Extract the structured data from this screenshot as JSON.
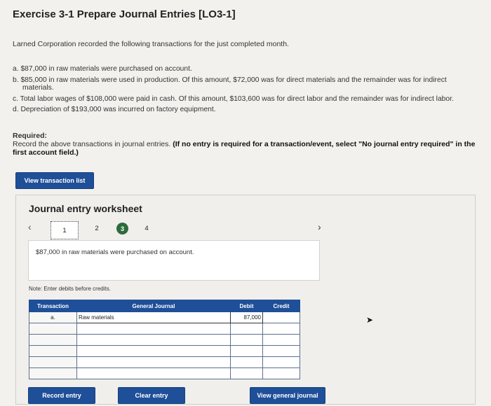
{
  "exercise": {
    "title": "Exercise 3-1 Prepare Journal Entries [LO3-1]",
    "intro": "Larned Corporation recorded the following transactions for the just completed month.",
    "transactions": [
      "a. $87,000 in raw materials were purchased on account.",
      "b. $85,000 in raw materials were used in production. Of this amount, $72,000 was for direct materials and the remainder was for indirect materials.",
      "c. Total labor wages of $108,000 were paid in cash. Of this amount, $103,600 was for direct labor and the remainder was for indirect labor.",
      "d. Depreciation of $193,000 was incurred on factory equipment."
    ],
    "required_heading": "Required:",
    "required_text": "Record the above transactions in journal entries.",
    "required_note": "(If no entry is required for a transaction/event, select \"No journal entry required\" in the first account field.)"
  },
  "buttons": {
    "view_transaction_list": "View transaction list",
    "record_entry": "Record entry",
    "clear_entry": "Clear entry",
    "view_general_journal": "View general journal"
  },
  "worksheet": {
    "title": "Journal entry worksheet",
    "prev_icon": "chevron-left-icon",
    "next_icon": "chevron-right-icon",
    "steps": [
      "1",
      "2",
      "3",
      "4"
    ],
    "current_step": "1",
    "completed_step": "3",
    "description": "$87,000 in raw materials were purchased on account.",
    "note": "Note: Enter debits before credits."
  },
  "journal_table": {
    "headers": {
      "transaction": "Transaction",
      "general_journal": "General Journal",
      "debit": "Debit",
      "credit": "Credit"
    },
    "rows": [
      {
        "transaction": "a.",
        "account": "Raw materials",
        "debit": "87,000",
        "credit": ""
      },
      {
        "transaction": "",
        "account": "",
        "debit": "",
        "credit": ""
      },
      {
        "transaction": "",
        "account": "",
        "debit": "",
        "credit": ""
      },
      {
        "transaction": "",
        "account": "",
        "debit": "",
        "credit": ""
      },
      {
        "transaction": "",
        "account": "",
        "debit": "",
        "credit": ""
      },
      {
        "transaction": "",
        "account": "",
        "debit": "",
        "credit": ""
      }
    ]
  },
  "colors": {
    "accent": "#1e4f98",
    "completed_step": "#2e6b3c",
    "background": "#f2f1ee"
  }
}
